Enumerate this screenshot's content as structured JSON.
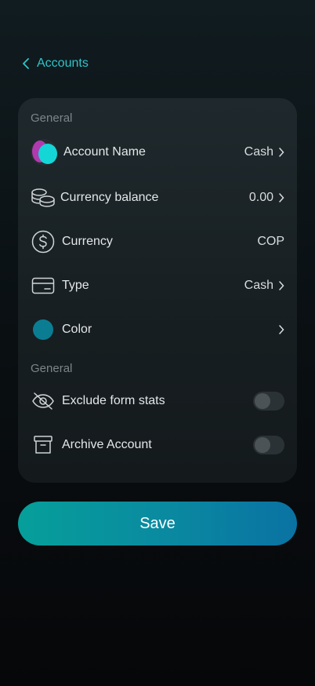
{
  "header": {
    "back_label": "Accounts"
  },
  "sections": {
    "general_1": "General",
    "general_2": "General"
  },
  "rows": {
    "account_name": {
      "label": "Account Name",
      "value": "Cash"
    },
    "currency_balance": {
      "label": "Currency balance",
      "value": "0.00"
    },
    "currency": {
      "label": "Currency",
      "value": "COP"
    },
    "type": {
      "label": "Type",
      "value": "Cash"
    },
    "color": {
      "label": "Color",
      "swatch": "#0a7d93"
    },
    "exclude_stats": {
      "label": "Exclude form stats",
      "enabled": false
    },
    "archive": {
      "label": "Archive Account",
      "enabled": false
    }
  },
  "save_label": "Save",
  "colors": {
    "accent": "#2fc4c9",
    "button_start": "#069f9a",
    "button_end": "#0a72a3"
  }
}
